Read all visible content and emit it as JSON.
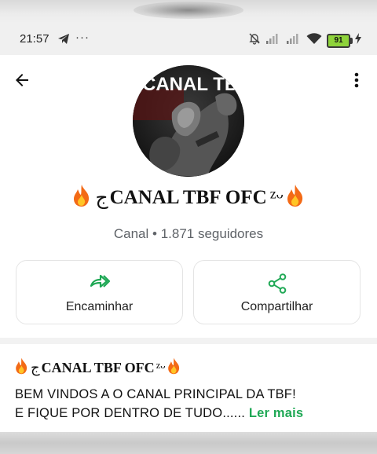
{
  "status_bar": {
    "time": "21:57",
    "battery": "91"
  },
  "channel": {
    "name_text": "CANAL TBF OFC",
    "name_prefix_glyph": "ج",
    "name_suffix_glyph": "ᶻᵕ",
    "avatar_text": "CANAL TBF",
    "subtitle": "Canal • 1.871 seguidores"
  },
  "actions": {
    "forward_label": "Encaminhar",
    "share_label": "Compartilhar"
  },
  "description": {
    "title": "CANAL TBF OFC",
    "line1": "BEM VINDOS A O CANAL PRINCIPAL DA TBF!",
    "line2": "E FIQUE POR DENTRO DE TUDO......",
    "read_more": "Ler mais"
  },
  "colors": {
    "accent_green": "#1fa855",
    "battery_green": "#8fd43b"
  },
  "icons": [
    "back-arrow-icon",
    "more-vert-icon",
    "forward-icon",
    "share-icon",
    "fire-icon",
    "telegram-icon",
    "mute-icon",
    "signal-icon",
    "wifi-icon",
    "battery-icon",
    "charging-icon"
  ]
}
